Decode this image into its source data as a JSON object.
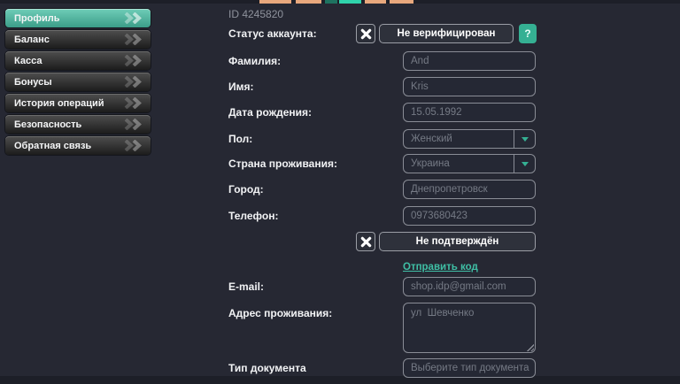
{
  "colors": {
    "background": "#262833",
    "accent_teal": "#3cb49b",
    "input_border": "#8a8d96",
    "logo_tan": "#e8a87d",
    "logo_teal_bright": "#2fd3ab",
    "logo_teal_dark": "#1e7360"
  },
  "sidebar": {
    "items": [
      {
        "label": "Профиль",
        "active": true
      },
      {
        "label": "Баланс",
        "active": false
      },
      {
        "label": "Касса",
        "active": false
      },
      {
        "label": "Бонусы",
        "active": false
      },
      {
        "label": "История операций",
        "active": false
      },
      {
        "label": "Безопасность",
        "active": false
      },
      {
        "label": "Обратная связь",
        "active": false
      }
    ]
  },
  "profile": {
    "user_id": "ID 4245820",
    "status": {
      "label": "Статус аккаунта:",
      "value": "Не верифицирован",
      "help": "?"
    },
    "fields": {
      "last_name": {
        "label": "Фамилия:",
        "value": "And"
      },
      "first_name": {
        "label": "Имя:",
        "value": "Kris"
      },
      "birth_date": {
        "label": "Дата рождения:",
        "value": "15.05.1992"
      },
      "gender": {
        "label": "Пол:",
        "value": "Женский"
      },
      "country": {
        "label": "Страна проживания:",
        "value": "Украина"
      },
      "city": {
        "label": "Город:",
        "value": "Днепропетровск"
      },
      "phone": {
        "label": "Телефон:",
        "value": "0973680423"
      },
      "email": {
        "label": "E-mail:",
        "value": "shop.idp@gmail.com"
      },
      "address": {
        "label": "Адрес проживания:",
        "value": "ул  Шевченко"
      },
      "document_type": {
        "label": "Тип документа",
        "value": "Выберите тип документа"
      }
    },
    "phone_status": {
      "value": "Не подтверждён"
    },
    "send_code_link": "Отправить код"
  }
}
